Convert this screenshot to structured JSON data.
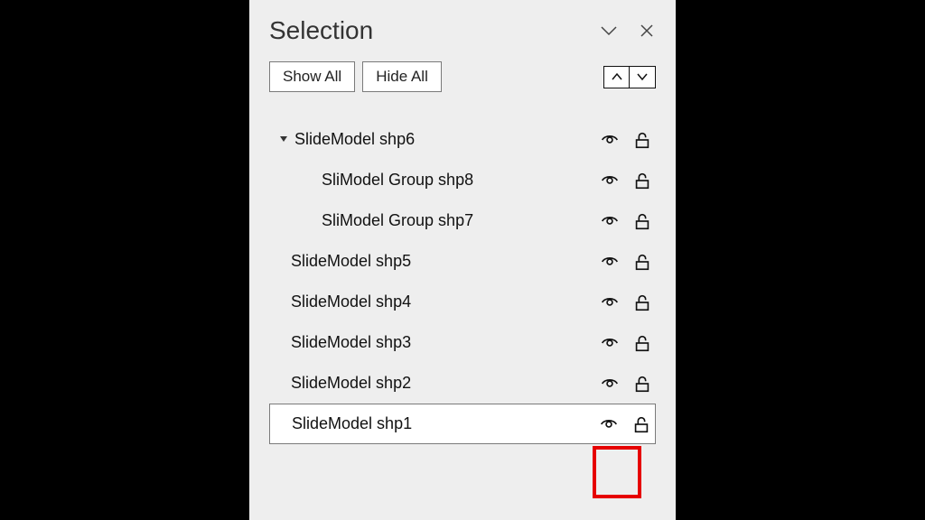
{
  "panel": {
    "title": "Selection",
    "show_all": "Show All",
    "hide_all": "Hide All"
  },
  "tree": {
    "items": [
      {
        "label": "SlideModel shp6",
        "indent": 0,
        "expanded": true,
        "has_children": true,
        "selected": false
      },
      {
        "label": "SliModel Group shp8",
        "indent": 1,
        "expanded": false,
        "has_children": false,
        "selected": false
      },
      {
        "label": "SliModel Group shp7",
        "indent": 1,
        "expanded": false,
        "has_children": false,
        "selected": false
      },
      {
        "label": "SlideModel shp5",
        "indent": 0,
        "expanded": false,
        "has_children": false,
        "selected": false
      },
      {
        "label": "SlideModel shp4",
        "indent": 0,
        "expanded": false,
        "has_children": false,
        "selected": false
      },
      {
        "label": "SlideModel shp3",
        "indent": 0,
        "expanded": false,
        "has_children": false,
        "selected": false
      },
      {
        "label": "SlideModel shp2",
        "indent": 0,
        "expanded": false,
        "has_children": false,
        "selected": false
      },
      {
        "label": "SlideModel shp1",
        "indent": 0,
        "expanded": false,
        "has_children": false,
        "selected": true
      }
    ]
  }
}
